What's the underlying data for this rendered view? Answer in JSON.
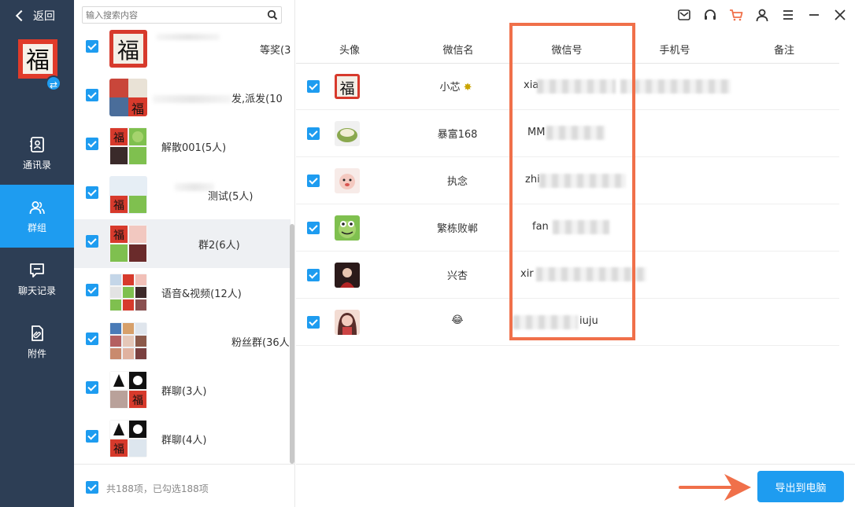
{
  "nav": {
    "back_label": "返回",
    "items": [
      {
        "label": "通讯录",
        "icon": "contacts-icon"
      },
      {
        "label": "群组",
        "icon": "group-icon"
      },
      {
        "label": "聊天记录",
        "icon": "chat-icon"
      },
      {
        "label": "附件",
        "icon": "attachment-icon"
      }
    ]
  },
  "search": {
    "placeholder": "输入搜索内容"
  },
  "groups": [
    {
      "name": "等奖(3"
    },
    {
      "name": "发,派发(10"
    },
    {
      "name": "解散001(5人)"
    },
    {
      "name": "测试(5人)"
    },
    {
      "name": "群2(6人)"
    },
    {
      "name": "语音&视频(12人)"
    },
    {
      "name": "粉丝群(36人)"
    },
    {
      "name": "群聊(3人)"
    },
    {
      "name": "群聊(4人)"
    }
  ],
  "footer": {
    "summary": "共188项，已勾选188项"
  },
  "table": {
    "headers": [
      "头像",
      "微信名",
      "微信号",
      "手机号",
      "备注"
    ],
    "rows": [
      {
        "nick": "小芯",
        "wxid_prefix": "xia",
        "wxid_suffix": ""
      },
      {
        "nick": "暴富168",
        "wxid_prefix": "MM",
        "wxid_suffix": ""
      },
      {
        "nick": "执念",
        "wxid_prefix": "zhi",
        "wxid_suffix": ""
      },
      {
        "nick": "繁栋败郸",
        "wxid_prefix": "fan",
        "wxid_suffix": ""
      },
      {
        "nick": "兴杏",
        "wxid_prefix": "xir",
        "wxid_suffix": ""
      },
      {
        "nick": "😂",
        "wxid_prefix": "",
        "wxid_suffix": "iuju"
      }
    ]
  },
  "export_button": "导出到电脑",
  "colors": {
    "accent": "#1e9cf0",
    "nav_bg": "#2d3e55",
    "highlight": "#f0704a"
  }
}
